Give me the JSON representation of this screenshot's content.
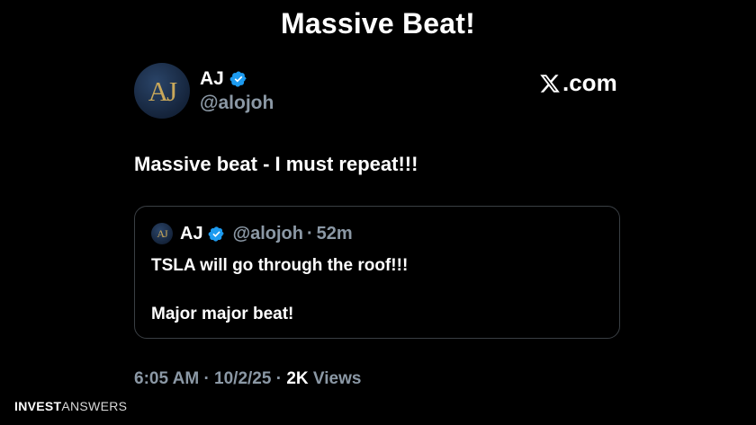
{
  "headline": "Massive Beat!",
  "site_label": ".com",
  "icons": {
    "site_logo": "x-logo-icon",
    "verified": "verified-badge-icon"
  },
  "colors": {
    "background": "#000000",
    "verified_blue": "#1d9bf0",
    "muted_text": "#8b98a5",
    "avatar_gold": "#c9a85a"
  },
  "post": {
    "avatar_initials": "AJ",
    "author_name": "AJ",
    "handle": "@alojoh",
    "text": "Massive beat - I must repeat!!!",
    "time": "6:05 AM",
    "date": "10/2/25",
    "views_count": "2K",
    "views_label": "Views",
    "separator": "·"
  },
  "quoted_post": {
    "avatar_initials": "AJ",
    "author_name": "AJ",
    "handle": "@alojoh",
    "separator": "·",
    "time_ago": "52m",
    "line1": "TSLA will go through the roof!!!",
    "line2": "Major major beat!"
  },
  "brand": {
    "part1": "INVEST",
    "part2": "ANSWERS"
  }
}
